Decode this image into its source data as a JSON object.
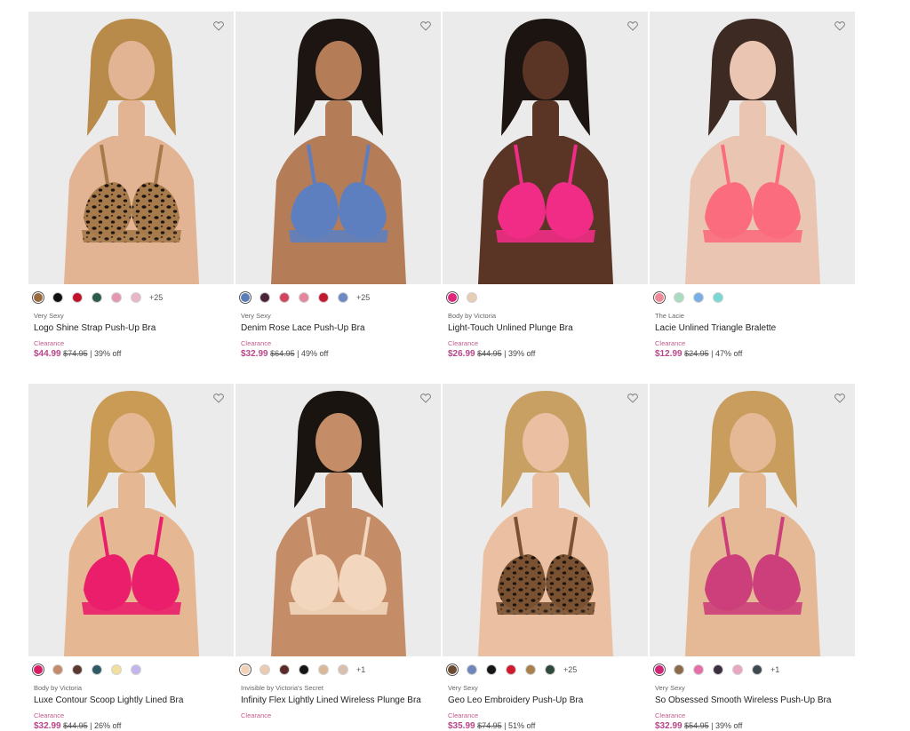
{
  "products": [
    {
      "brand": "Very Sexy",
      "name": "Logo Shine Strap Push-Up Bra",
      "status": "Clearance",
      "sale_price": "$44.99",
      "original_price": "$74.95",
      "discount": "| 39% off",
      "more_colors": "+25",
      "swatches": [
        "#9a6a3f",
        "#111111",
        "#c0122a",
        "#2d5b4a",
        "#e596b2",
        "#e8b6c8"
      ],
      "bra_color": "#a67a4a",
      "bra_pattern": "leopard",
      "skin": "#e3b493",
      "hair": "#b88b4a"
    },
    {
      "brand": "Very Sexy",
      "name": "Denim Rose Lace Push-Up Bra",
      "status": "Clearance",
      "sale_price": "$32.99",
      "original_price": "$64.95",
      "discount": "| 49% off",
      "more_colors": "+25",
      "swatches": [
        "#5b7eb8",
        "#4a2438",
        "#d2445c",
        "#e6869e",
        "#c21a30",
        "#6e88c4"
      ],
      "bra_color": "#5d7fbf",
      "bra_pattern": "plain",
      "skin": "#b57c58",
      "hair": "#1c1512"
    },
    {
      "brand": "Body by Victoria",
      "name": "Light-Touch Unlined Plunge Bra",
      "status": "Clearance",
      "sale_price": "$26.99",
      "original_price": "$44.95",
      "discount": "| 39% off",
      "more_colors": "",
      "swatches": [
        "#e0267a",
        "#e6cdb4"
      ],
      "bra_color": "#f12c86",
      "bra_pattern": "plain",
      "skin": "#5a3526",
      "hair": "#1b1411"
    },
    {
      "brand": "The Lacie",
      "name": "Lacie Unlined Triangle Bralette",
      "status": "Clearance",
      "sale_price": "$12.99",
      "original_price": "$24.95",
      "discount": "| 47% off",
      "more_colors": "",
      "swatches": [
        "#f08a98",
        "#a9dcc0",
        "#79aee6",
        "#77d9d2"
      ],
      "bra_color": "#fb6c7e",
      "bra_pattern": "plain",
      "skin": "#eac6b2",
      "hair": "#3d2a22"
    },
    {
      "brand": "Body by Victoria",
      "name": "Luxe Contour Scoop Lightly Lined Bra",
      "status": "Clearance",
      "sale_price": "$32.99",
      "original_price": "$44.95",
      "discount": "| 26% off",
      "more_colors": "",
      "swatches": [
        "#d61e66",
        "#c58a6a",
        "#5a3a30",
        "#2d5a64",
        "#f1df9c",
        "#c4b6ec"
      ],
      "bra_color": "#ea1e6a",
      "bra_pattern": "plain",
      "skin": "#e6b793",
      "hair": "#c99b55"
    },
    {
      "brand": "Invisible by Victoria's Secret",
      "name": "Infinity Flex Lightly Lined Wireless Plunge Bra",
      "status": "Clearance",
      "sale_price": "",
      "original_price": "",
      "discount": "",
      "more_colors": "+1",
      "swatches": [
        "#f2d2b6",
        "#e9cbb1",
        "#5a2a2a",
        "#151515",
        "#d9b89a",
        "#d9bfae"
      ],
      "bra_color": "#f2d6bd",
      "bra_pattern": "plain",
      "skin": "#c48d68",
      "hair": "#1a1410"
    },
    {
      "brand": "Very Sexy",
      "name": "Geo Leo Embroidery Push-Up Bra",
      "status": "Clearance",
      "sale_price": "$35.99",
      "original_price": "$74.95",
      "discount": "| 51% off",
      "more_colors": "+25",
      "swatches": [
        "#6b4a32",
        "#6f86bb",
        "#161616",
        "#d01a2c",
        "#a9804c",
        "#2f4a3c"
      ],
      "bra_color": "#7a5232",
      "bra_pattern": "leopard",
      "skin": "#ebc0a2",
      "hair": "#c9a064"
    },
    {
      "brand": "Very Sexy",
      "name": "So Obsessed Smooth Wireless Push-Up Bra",
      "status": "Clearance",
      "sale_price": "$32.99",
      "original_price": "$54.95",
      "discount": "| 39% off",
      "more_colors": "+1",
      "swatches": [
        "#cf2776",
        "#8a6b4a",
        "#e56fa8",
        "#3a2f3f",
        "#e8a6c0",
        "#3c4a50"
      ],
      "bra_color": "#cc3f7a",
      "bra_pattern": "plain",
      "skin": "#e5b896",
      "hair": "#c99d5e"
    }
  ],
  "icons": {
    "favorite": "heart-outline-icon"
  },
  "colors": {
    "sale": "#b7478a",
    "clearance": "#c05c8c",
    "photo_bg": "#ebebeb"
  }
}
